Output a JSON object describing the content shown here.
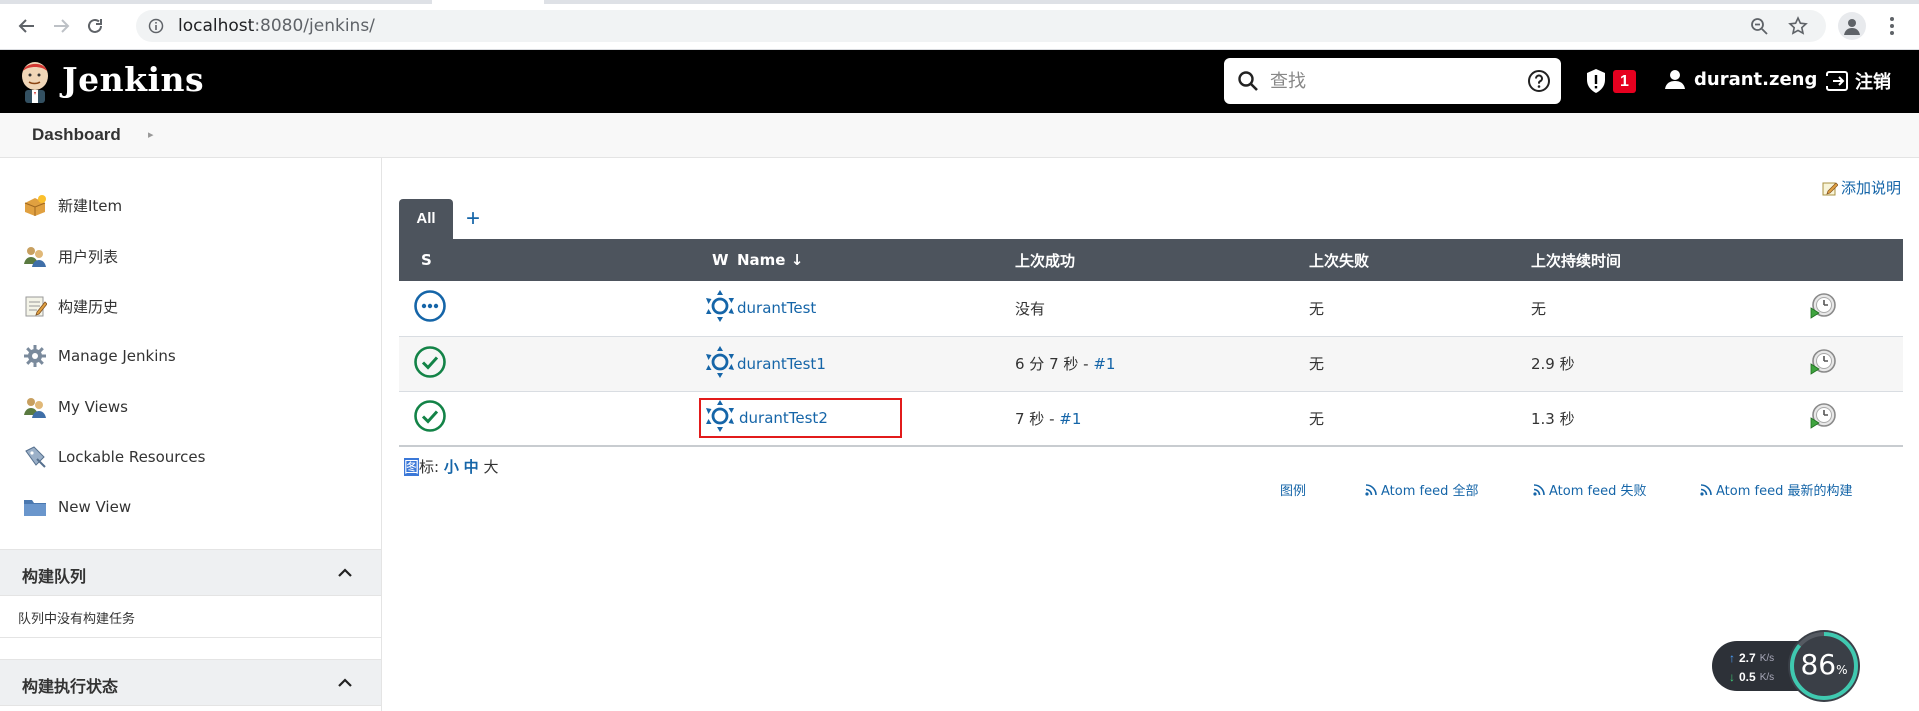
{
  "browser": {
    "url_host": "localhost",
    "url_rest": ":8080/jenkins/"
  },
  "header": {
    "brand": "Jenkins",
    "search_placeholder": "查找",
    "security_badge": "1",
    "user": "durant.zeng",
    "logout": "注销"
  },
  "breadcrumb": {
    "dashboard": "Dashboard"
  },
  "sidebar": {
    "tasks": [
      {
        "label": "新建Item",
        "icon": "new-item-icon"
      },
      {
        "label": "用户列表",
        "icon": "users-icon"
      },
      {
        "label": "构建历史",
        "icon": "build-history-icon"
      },
      {
        "label": "Manage Jenkins",
        "icon": "gear-icon"
      },
      {
        "label": "My Views",
        "icon": "my-views-icon"
      },
      {
        "label": "Lockable Resources",
        "icon": "lockable-resources-icon"
      },
      {
        "label": "New View",
        "icon": "folder-icon"
      }
    ],
    "build_queue": {
      "title": "构建队列",
      "empty": "队列中没有构建任务"
    },
    "executor_status": {
      "title": "构建执行状态"
    }
  },
  "main": {
    "add_description": "添加说明",
    "tab_all": "All",
    "tab_add": "+",
    "columns": {
      "s": "S",
      "w": "W",
      "name": "Name ↓",
      "last_success": "上次成功",
      "last_failure": "上次失败",
      "last_duration": "上次持续时间"
    },
    "jobs": [
      {
        "status": "not-built",
        "name": "durantTest",
        "last_success": "没有",
        "last_success_build": "",
        "last_failure": "无",
        "last_duration": "无"
      },
      {
        "status": "success",
        "name": "durantTest1",
        "last_success": "6 分 7 秒 - ",
        "last_success_build": "#1",
        "last_failure": "无",
        "last_duration": "2.9 秒"
      },
      {
        "status": "success",
        "name": "durantTest2",
        "last_success": "7 秒 - ",
        "last_success_build": "#1",
        "last_failure": "无",
        "last_duration": "1.3 秒"
      }
    ],
    "icon_size": {
      "label_sel": "图",
      "label_rest": "标: ",
      "small": "小",
      "medium": "中",
      "large": "大"
    },
    "feeds": {
      "legend": "图例",
      "atom_all": "Atom feed 全部",
      "atom_failed": "Atom feed 失败",
      "atom_latest": "Atom feed 最新的构建"
    }
  },
  "net_widget": {
    "upload": "2.7",
    "download": "0.5",
    "unit": "K/s",
    "cpu": "86",
    "cpu_unit": "%"
  },
  "colors": {
    "header_bg": "#000000",
    "table_header_bg": "#4d545d",
    "link": "#1565a8",
    "success_green": "#138347",
    "highlight_red": "#e21b1b"
  }
}
